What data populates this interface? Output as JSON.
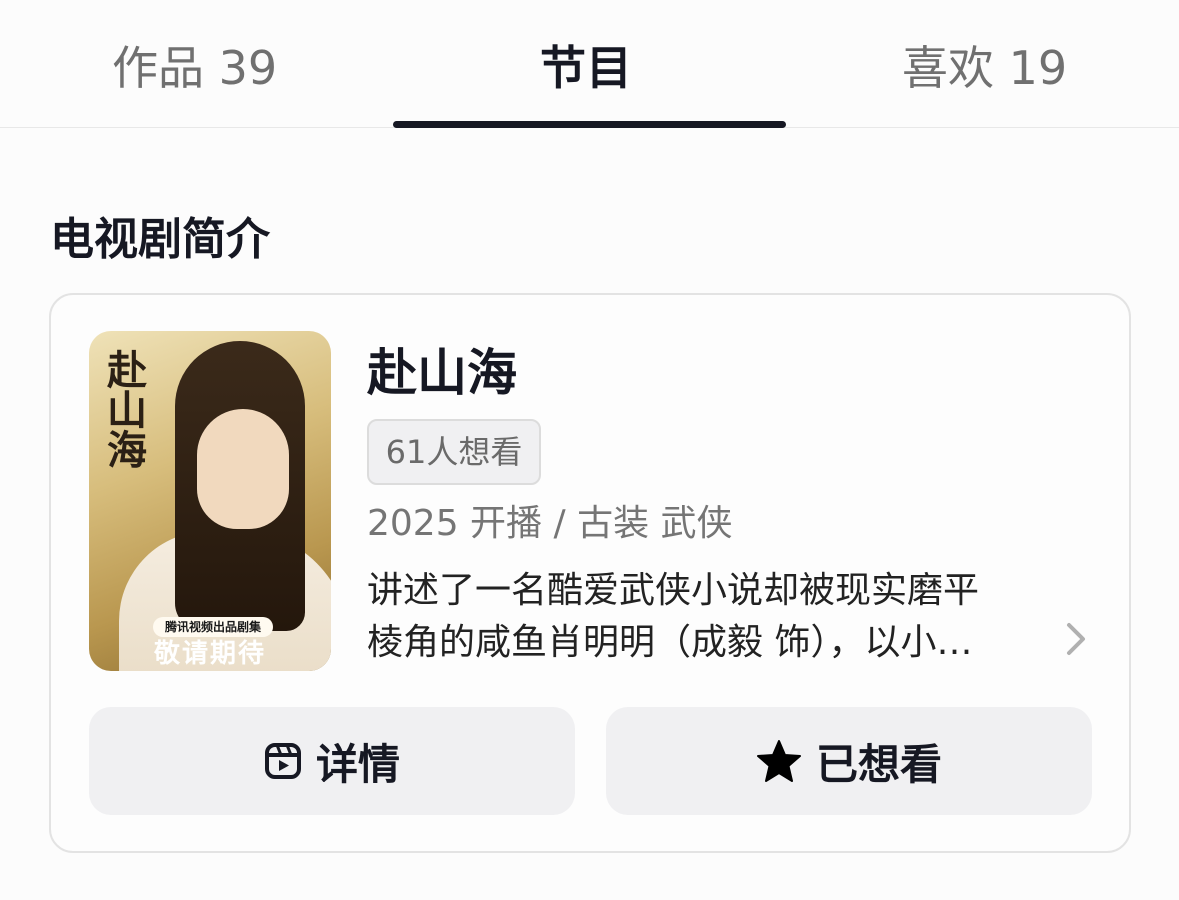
{
  "tabs": [
    {
      "label": "作品 39"
    },
    {
      "label": "节目"
    },
    {
      "label": "喜欢 19"
    }
  ],
  "section": {
    "title": "电视剧简介"
  },
  "show": {
    "title": "赴山海",
    "want_count": "61人想看",
    "meta": "2025 开播 / 古装 武侠",
    "desc_line1": "讲述了一名酷爱武侠小说却被现实磨平",
    "desc_line2": "棱角的咸鱼肖明明（成毅 饰），以小…",
    "poster": {
      "title": "赴山海",
      "presenter": "腾讯视频出品剧集",
      "coming": "敬请期待"
    }
  },
  "buttons": {
    "detail": {
      "label": "详情",
      "icon": "film-icon"
    },
    "want": {
      "label": "已想看",
      "icon": "star-icon"
    }
  },
  "colors": {
    "text_primary": "#161823",
    "text_secondary": "#757575",
    "button_bg": "#f0f0f2",
    "card_border": "#e3e3e3"
  }
}
